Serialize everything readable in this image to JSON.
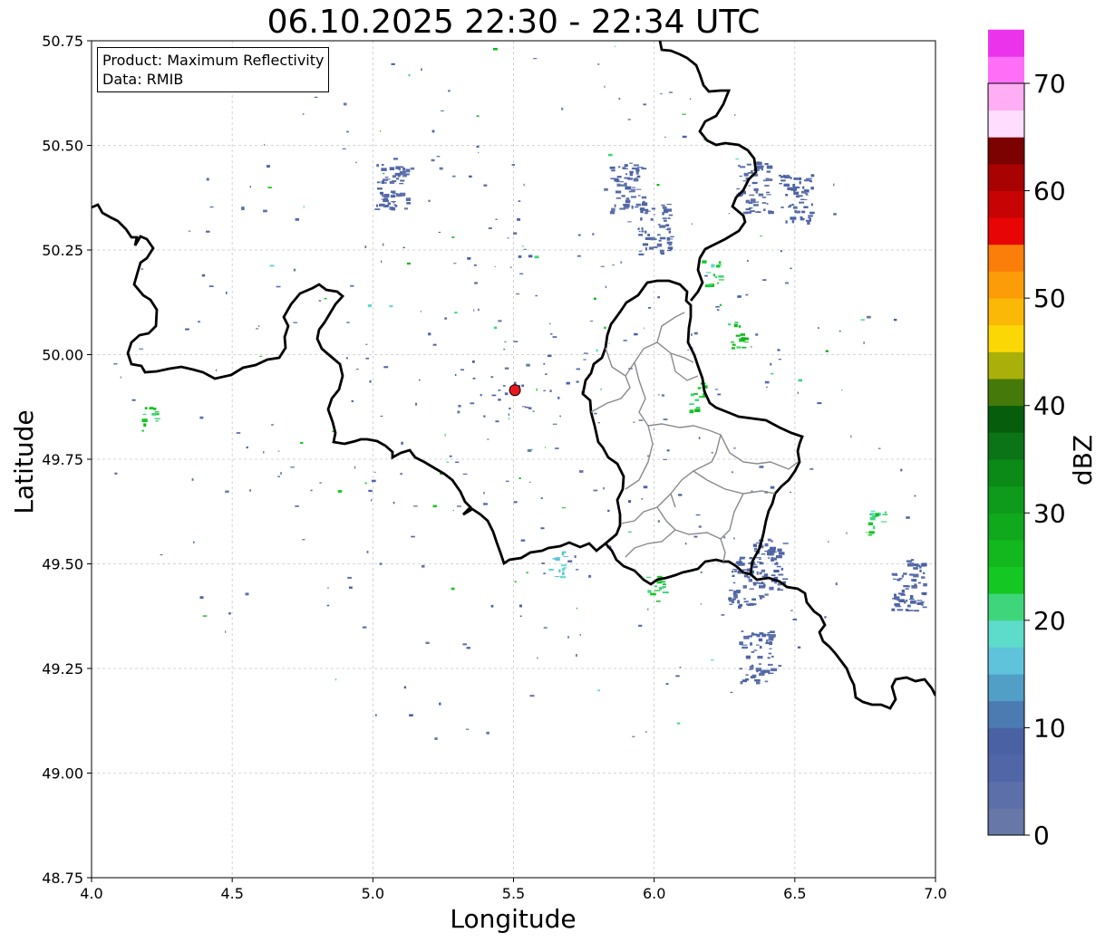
{
  "title": "06.10.2025 22:30 - 22:34 UTC",
  "info_box": {
    "product": "Product: Maximum Reflectivity",
    "data": "Data: RMIB"
  },
  "axes": {
    "xlabel": "Longitude",
    "ylabel": "Latitude",
    "xlim": [
      4.0,
      7.0
    ],
    "ylim": [
      48.75,
      50.75
    ],
    "xticks": [
      "4.0",
      "4.5",
      "5.0",
      "5.5",
      "6.0",
      "6.5",
      "7.0"
    ],
    "yticks": [
      "50.75",
      "50.50",
      "50.25",
      "50.00",
      "49.75",
      "49.50",
      "49.25",
      "49.00",
      "48.75"
    ],
    "grid": true
  },
  "colorbar": {
    "label": "dBZ",
    "ticks": [
      "70",
      "60",
      "50",
      "40",
      "30",
      "20",
      "10",
      "0"
    ],
    "range": [
      0,
      70
    ],
    "step": 2.5,
    "colors": [
      "#6677a8",
      "#5d6fa8",
      "#5166a6",
      "#4a62a4",
      "#4b7bb0",
      "#519ec6",
      "#5fc3dc",
      "#5ddbcb",
      "#3fd67b",
      "#14c722",
      "#12b81e",
      "#10a81c",
      "#0e9a1b",
      "#0b8a18",
      "#0b7416",
      "#065e0d",
      "#457a0a",
      "#aab00a",
      "#fbd805",
      "#fbb806",
      "#fb9c08",
      "#fb7e0a",
      "#e80505",
      "#c80303",
      "#a80202",
      "#7c0101",
      "#ffddff",
      "#ffadf5",
      "#ff6ef7",
      "#ec33ec"
    ]
  },
  "radar_site": {
    "lon": 5.505,
    "lat": 49.915,
    "color": "#e8191e"
  },
  "chart_data": {
    "type": "heatmap",
    "title": "06.10.2025 22:30 - 22:34 UTC",
    "xlabel": "Longitude",
    "ylabel": "Latitude",
    "xlim": [
      4.0,
      7.0
    ],
    "ylim": [
      48.75,
      50.75
    ],
    "colorbar_label": "dBZ",
    "colorbar_range": [
      0,
      70
    ],
    "echo_areas": [
      {
        "lon": 5.06,
        "lat": 50.41,
        "dbz": 5
      },
      {
        "lon": 5.9,
        "lat": 50.4,
        "dbz": 5
      },
      {
        "lon": 6.0,
        "lat": 50.3,
        "dbz": 6
      },
      {
        "lon": 6.35,
        "lat": 50.4,
        "dbz": 5
      },
      {
        "lon": 6.5,
        "lat": 50.37,
        "dbz": 6
      },
      {
        "lon": 6.32,
        "lat": 49.46,
        "dbz": 6
      },
      {
        "lon": 6.4,
        "lat": 49.5,
        "dbz": 6
      },
      {
        "lon": 6.36,
        "lat": 49.28,
        "dbz": 5
      },
      {
        "lon": 6.9,
        "lat": 49.45,
        "dbz": 6
      },
      {
        "lon": 6.2,
        "lat": 50.2,
        "dbz": 22
      },
      {
        "lon": 6.3,
        "lat": 50.05,
        "dbz": 25
      },
      {
        "lon": 6.15,
        "lat": 49.9,
        "dbz": 24
      },
      {
        "lon": 6.0,
        "lat": 49.45,
        "dbz": 23
      },
      {
        "lon": 5.65,
        "lat": 49.5,
        "dbz": 18
      },
      {
        "lon": 6.78,
        "lat": 49.6,
        "dbz": 22
      },
      {
        "lon": 4.2,
        "lat": 49.85,
        "dbz": 24
      }
    ],
    "borders": "country and regional outlines (Belgium, France, Luxembourg, Germany)"
  }
}
